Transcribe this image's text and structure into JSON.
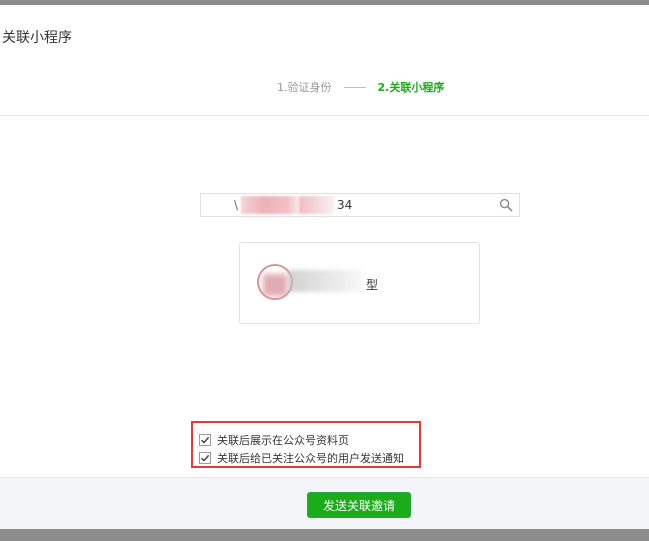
{
  "dialog": {
    "title": "关联小程序"
  },
  "steps": [
    {
      "label": "1.验证身份",
      "active": false
    },
    {
      "label": "2.关联小程序",
      "active": true
    }
  ],
  "search": {
    "prefix": "\\",
    "value": "34",
    "icon": "search-icon"
  },
  "result": {
    "name_suffix": "型",
    "avatar_icon": "mini-program-avatar"
  },
  "options": [
    {
      "label": "关联后展示在公众号资料页",
      "checked": true
    },
    {
      "label": "关联后给已关注公众号的用户发送通知",
      "checked": true
    }
  ],
  "footer": {
    "send_label": "发送关联邀请"
  },
  "colors": {
    "accent": "#1aad19",
    "highlight": "#e53935"
  }
}
